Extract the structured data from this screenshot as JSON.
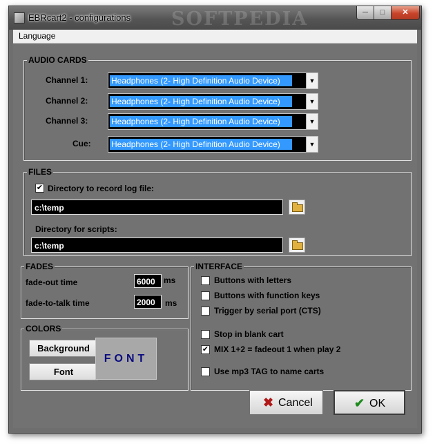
{
  "window": {
    "title": "EBRcart2 - configurations",
    "watermark": "SOFTPEDIA"
  },
  "menu": {
    "language": "Language"
  },
  "audio_cards": {
    "title": "AUDIO CARDS",
    "rows": [
      {
        "label": "Channel 1:",
        "value": "Headphones (2- High Definition Audio Device)"
      },
      {
        "label": "Channel 2:",
        "value": "Headphones (2- High Definition Audio Device)"
      },
      {
        "label": "Channel 3:",
        "value": "Headphones (2- High Definition Audio Device)"
      },
      {
        "label": "Cue:",
        "value": "Headphones (2- High Definition Audio Device)"
      }
    ]
  },
  "files": {
    "title": "FILES",
    "log_checkbox_label": "Directory to record log file:",
    "log_checked": true,
    "log_dir": "c:\\temp",
    "scripts_label": "Directory for scripts:",
    "scripts_dir": "c:\\temp"
  },
  "fades": {
    "title": "FADES",
    "fade_out_label": "fade-out time",
    "fade_out_value": "6000",
    "fade_out_unit": "ms",
    "fade_talk_label": "fade-to-talk time",
    "fade_talk_value": "2000",
    "fade_talk_unit": "ms"
  },
  "colors": {
    "title": "COLORS",
    "background_button": "Background",
    "font_button": "Font",
    "font_preview": "FONT",
    "preview_text_color": "#0a0a80"
  },
  "interface": {
    "title": "INTERFACE",
    "options": [
      {
        "label": "Buttons with letters",
        "checked": false
      },
      {
        "label": "Buttons with function keys",
        "checked": false
      },
      {
        "label": "Trigger by serial port (CTS)",
        "checked": false
      },
      {
        "label": "Stop in blank cart",
        "checked": false
      },
      {
        "label": "MIX 1+2 = fadeout 1 when play 2",
        "checked": true
      },
      {
        "label": "Use mp3 TAG to name carts",
        "checked": false
      }
    ]
  },
  "buttons": {
    "cancel": "Cancel",
    "ok": "OK"
  },
  "icons": {
    "app": "app-icon",
    "minimize": "minimize-icon",
    "maximize": "maximize-icon",
    "close": "close-icon",
    "folder": "folder-icon",
    "cancel": "cross-icon",
    "ok": "checkmark-icon"
  }
}
